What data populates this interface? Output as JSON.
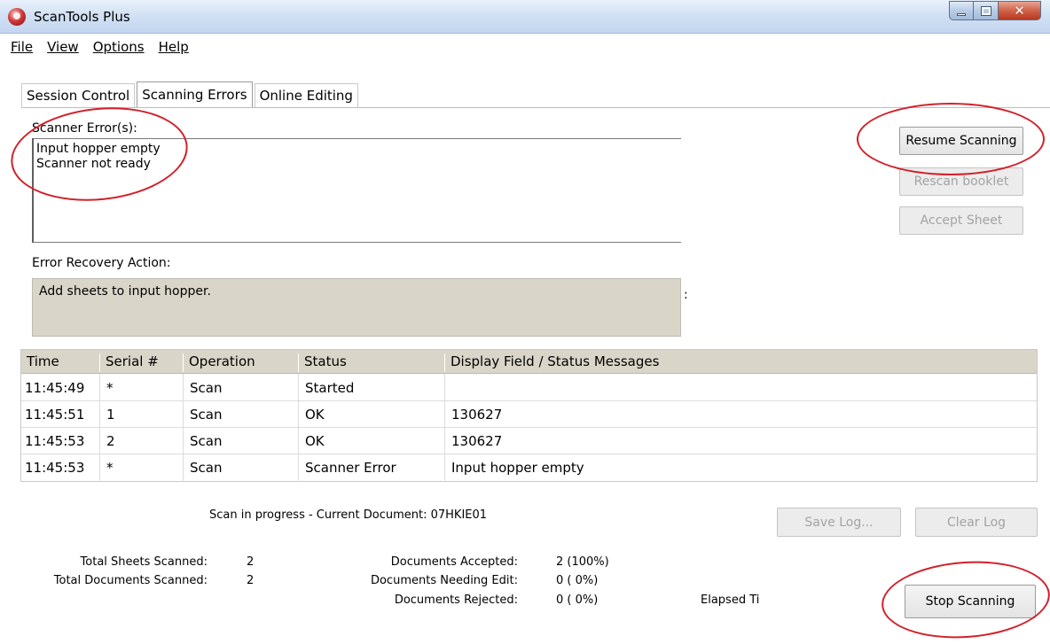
{
  "window": {
    "title": "ScanTools Plus"
  },
  "menu": [
    "File",
    "View",
    "Options",
    "Help"
  ],
  "tabs": [
    "Session Control",
    "Scanning Errors",
    "Online Editing"
  ],
  "active_tab": "Scanning Errors",
  "errors": {
    "label": "Scanner Error(s):",
    "items": [
      "Input hopper empty",
      "Scanner not ready"
    ]
  },
  "recovery": {
    "label": "Error Recovery Action:",
    "text": "Add sheets to input hopper.",
    "trailing_mark": ":"
  },
  "buttons": {
    "resume": "Resume Scanning",
    "rescan": "Rescan booklet",
    "accept": "Accept Sheet",
    "save_log": "Save Log...",
    "clear_log": "Clear Log",
    "stop": "Stop Scanning"
  },
  "log": {
    "columns": [
      "Time",
      "Serial #",
      "Operation",
      "Status",
      "Display Field / Status Messages"
    ],
    "rows": [
      [
        "11:45:49",
        "*",
        "Scan",
        "Started",
        ""
      ],
      [
        "11:45:51",
        "1",
        "Scan",
        "OK",
        "130627"
      ],
      [
        "11:45:53",
        "2",
        "Scan",
        "OK",
        "130627"
      ],
      [
        "11:45:53",
        "*",
        "Scan",
        "Scanner Error",
        "Input hopper empty"
      ]
    ]
  },
  "status": {
    "progress": "Scan in progress - Current Document: 07HKIE01",
    "total_sheets_label": "Total Sheets Scanned:",
    "total_sheets_value": "2",
    "total_docs_label": "Total Documents Scanned:",
    "total_docs_value": "2",
    "accepted_label": "Documents Accepted:",
    "accepted_value": "2 (100%)",
    "needing_edit_label": "Documents Needing Edit:",
    "needing_edit_value": "0 ( 0%)",
    "rejected_label": "Documents Rejected:",
    "rejected_value": "0 ( 0%)",
    "elapsed_label": "Elapsed Ti"
  },
  "colors": {
    "annotation_ring": "#d2202a",
    "panel_gray": "#d9d6c9"
  }
}
